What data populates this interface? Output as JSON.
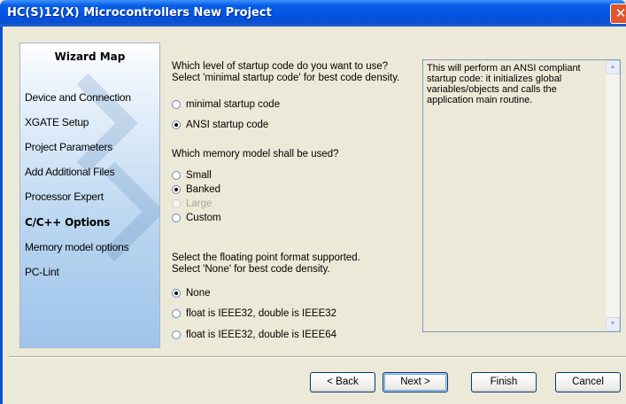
{
  "window": {
    "title": "HC(S)12(X) Microcontrollers New Project",
    "close_glyph": "✕"
  },
  "wizard_map": {
    "heading": "Wizard Map",
    "items": [
      {
        "label": "Device and Connection",
        "active": false
      },
      {
        "label": "XGATE Setup",
        "active": false
      },
      {
        "label": "Project Parameters",
        "active": false
      },
      {
        "label": "Add Additional Files",
        "active": false
      },
      {
        "label": "Processor Expert",
        "active": false
      },
      {
        "label": "C/C++ Options",
        "active": true
      },
      {
        "label": "Memory model options",
        "active": false
      },
      {
        "label": "PC-Lint",
        "active": false
      }
    ]
  },
  "startup": {
    "question_line1": "Which level of startup code do you want to use?",
    "question_line2": "Select 'minimal startup code' for best code density.",
    "options": [
      {
        "label": "minimal startup code",
        "selected": false
      },
      {
        "label": "ANSI startup code",
        "selected": true
      }
    ]
  },
  "memory_model": {
    "question": "Which memory model shall be used?",
    "options": [
      {
        "label": "Small",
        "selected": false,
        "enabled": true
      },
      {
        "label": "Banked",
        "selected": true,
        "enabled": true
      },
      {
        "label": "Large",
        "selected": false,
        "enabled": false
      },
      {
        "label": "Custom",
        "selected": false,
        "enabled": true
      }
    ]
  },
  "floating_point": {
    "question_line1": "Select the floating point format supported.",
    "question_line2": "Select 'None' for best code density.",
    "options": [
      {
        "label": "None",
        "selected": true
      },
      {
        "label": "float is IEEE32, double is IEEE32",
        "selected": false
      },
      {
        "label": "float is IEEE32, double is IEEE64",
        "selected": false
      }
    ]
  },
  "info": {
    "text": "This will perform an ANSI compliant\nstartup code: it initializes global\nvariables/objects and calls the\napplication main routine."
  },
  "buttons": {
    "back": "< Back",
    "next": "Next >",
    "finish": "Finish",
    "cancel": "Cancel"
  },
  "colors": {
    "title_bar": "#0054e3",
    "dialog_bg": "#ece9d8",
    "wizard_map_gradient_end": "#9ec4ea"
  }
}
